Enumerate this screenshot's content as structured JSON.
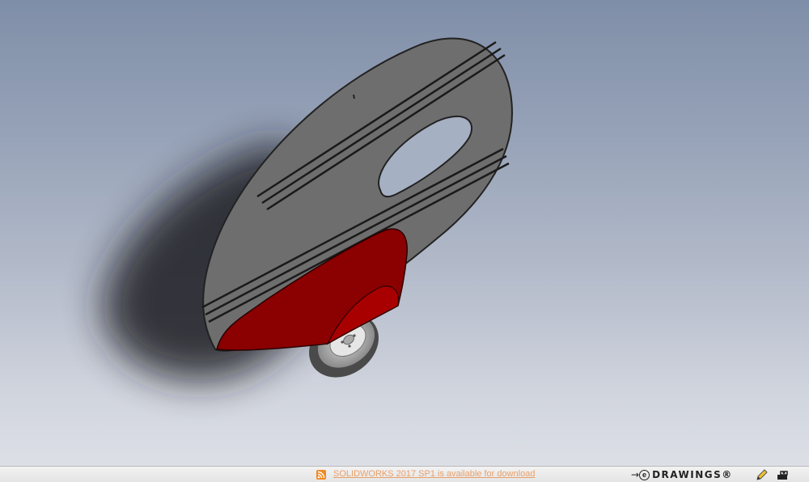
{
  "status_bar": {
    "news_text": "SOLIDWORKS 2017 SP1 is available for download",
    "brand_arrow": "→",
    "brand_e": "e",
    "brand_name": "DRAWINGS®"
  },
  "icons": {
    "news": "rss-icon",
    "markup": "pencil-icon",
    "measure": "measure-icon"
  },
  "colors": {
    "panel": "#6e6e6e",
    "fairing": "#8b0000",
    "news_link": "#e9a06a"
  }
}
